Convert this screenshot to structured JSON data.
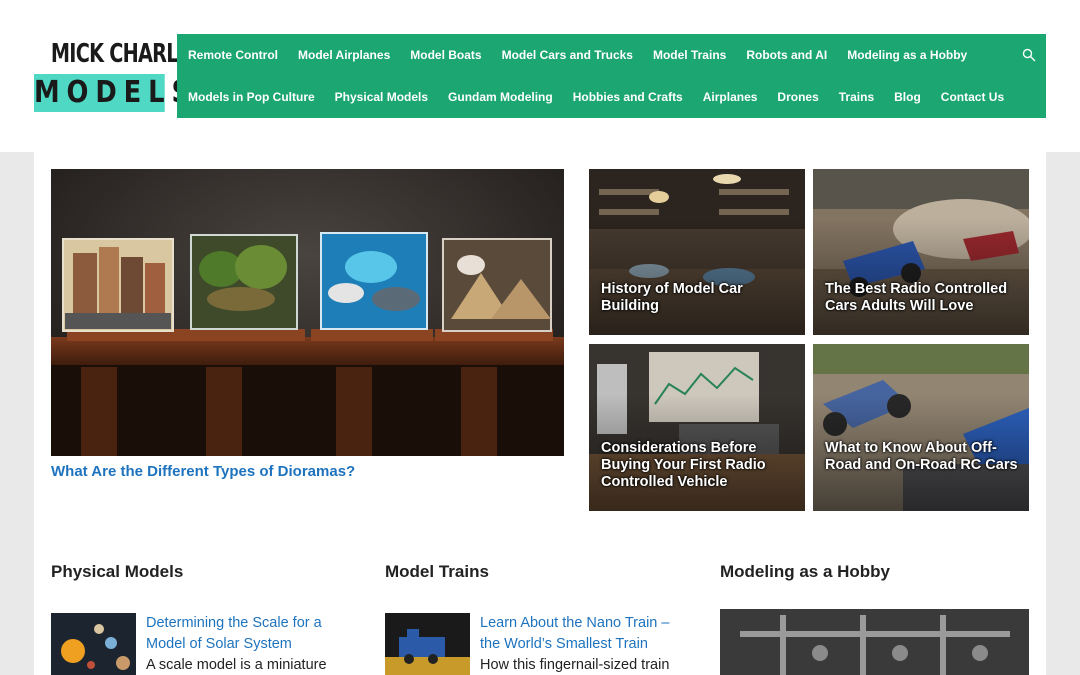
{
  "logo": {
    "line1": "MICK CHARLES",
    "line2": "MODELS"
  },
  "nav": {
    "row1": [
      "Remote Control",
      "Model Airplanes",
      "Model Boats",
      "Model Cars and Trucks",
      "Model Trains",
      "Robots and AI",
      "Modeling as a Hobby"
    ],
    "row2": [
      "Models in Pop Culture",
      "Physical Models",
      "Gundam Modeling",
      "Hobbies and Crafts",
      "Airplanes",
      "Drones",
      "Trains",
      "Blog",
      "Contact Us"
    ],
    "search_icon": "search-icon"
  },
  "featured": {
    "hero_title": "What Are the Different Types of Dioramas?",
    "tiles": [
      {
        "title": "History of Model Car Building"
      },
      {
        "title": "The Best Radio Controlled Cars Adults Will Love"
      },
      {
        "title": "Considerations Before Buying Your First Radio Controlled Vehicle"
      },
      {
        "title": "What to Know About Off-Road and On-Road RC Cars"
      }
    ]
  },
  "sections": [
    {
      "title": "Physical Models",
      "post_title": "Determining the Scale for a Model of Solar System",
      "excerpt": "A scale model is a miniature"
    },
    {
      "title": "Model Trains",
      "post_title": "Learn About the Nano Train – the World’s Smallest Train",
      "excerpt": "How this fingernail-sized train"
    },
    {
      "title": "Modeling as a Hobby"
    }
  ],
  "colors": {
    "nav_bg": "#1ba672",
    "link": "#1e73be",
    "logo_accent": "#4fd9c4"
  }
}
